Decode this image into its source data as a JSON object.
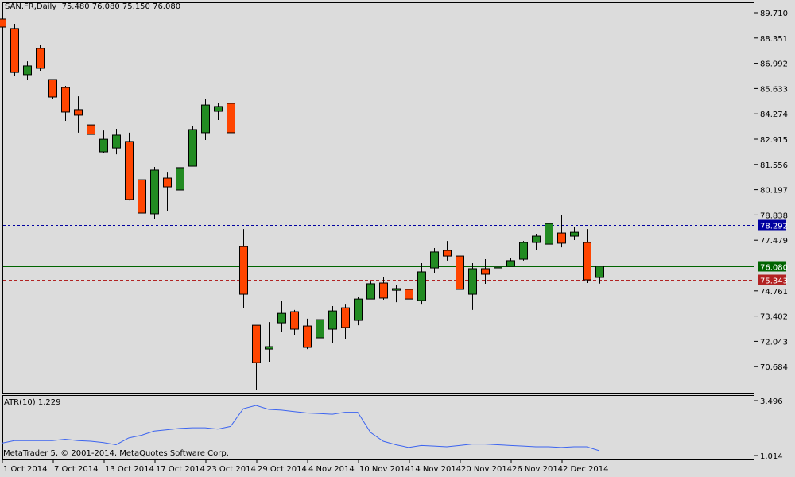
{
  "header": {
    "symbol": "SAN.FR,Daily",
    "ohlc": "75.480 76.080 75.150 76.080"
  },
  "indicator": {
    "label": "ATR(10) 1.229",
    "axis_labels": [
      "3.496",
      "1.014"
    ]
  },
  "copyright": "MetaTrader 5, © 2001-2014, MetaQuotes Software Corp.",
  "colors": {
    "background": "#dcdcdc",
    "bull": "#228b22",
    "bear": "#ff4500",
    "atr_line": "#3c64f0",
    "line_blue": "#0000a0",
    "line_green": "#006400",
    "line_red": "#b22222"
  },
  "price_axis": [
    "89.710",
    "88.351",
    "86.992",
    "85.633",
    "84.274",
    "82.915",
    "81.556",
    "80.197",
    "78.838",
    "77.479",
    "74.761",
    "73.402",
    "72.043",
    "70.684"
  ],
  "price_lines": [
    {
      "name": "blue-level",
      "value": "78.292",
      "color": "#0000a0",
      "style": "dotted"
    },
    {
      "name": "bid-level",
      "value": "76.080",
      "color": "#006400",
      "style": "solid"
    },
    {
      "name": "red-level",
      "value": "75.343",
      "color": "#b22222",
      "style": "dashed"
    }
  ],
  "date_axis": [
    {
      "label": "1 Oct 2014",
      "bar": 0
    },
    {
      "label": "7 Oct 2014",
      "bar": 4
    },
    {
      "label": "13 Oct 2014",
      "bar": 8
    },
    {
      "label": "17 Oct 2014",
      "bar": 12
    },
    {
      "label": "23 Oct 2014",
      "bar": 16
    },
    {
      "label": "29 Oct 2014",
      "bar": 20
    },
    {
      "label": "4 Nov 2014",
      "bar": 24
    },
    {
      "label": "10 Nov 2014",
      "bar": 28
    },
    {
      "label": "14 Nov 2014",
      "bar": 32
    },
    {
      "label": "20 Nov 2014",
      "bar": 36
    },
    {
      "label": "26 Nov 2014",
      "bar": 40
    },
    {
      "label": "2 Dec 2014",
      "bar": 44
    }
  ],
  "chart_data": {
    "type": "candlestick",
    "title": "SAN.FR,Daily",
    "ylim": [
      69.45,
      89.71
    ],
    "ohlc": [
      [
        89.37,
        89.37,
        88.94,
        88.94
      ],
      [
        88.86,
        89.11,
        86.33,
        86.5
      ],
      [
        86.38,
        87.1,
        86.12,
        86.85
      ],
      [
        87.79,
        87.96,
        86.59,
        86.72
      ],
      [
        86.12,
        86.12,
        85.05,
        85.18
      ],
      [
        85.69,
        85.78,
        83.9,
        84.37
      ],
      [
        84.5,
        85.22,
        83.26,
        84.2
      ],
      [
        83.68,
        84.07,
        82.83,
        83.17
      ],
      [
        82.23,
        83.38,
        82.15,
        82.91
      ],
      [
        82.44,
        83.47,
        82.1,
        83.13
      ],
      [
        82.79,
        83.26,
        79.62,
        79.67
      ],
      [
        80.73,
        81.29,
        77.27,
        78.94
      ],
      [
        78.9,
        81.42,
        78.6,
        81.25
      ],
      [
        80.82,
        81.16,
        79.07,
        80.35
      ],
      [
        80.18,
        81.55,
        79.5,
        81.38
      ],
      [
        81.46,
        83.64,
        81.46,
        83.43
      ],
      [
        83.26,
        85.09,
        82.87,
        84.75
      ],
      [
        84.41,
        84.88,
        83.94,
        84.67
      ],
      [
        84.84,
        85.14,
        82.79,
        83.26
      ],
      [
        77.14,
        78.08,
        73.81,
        74.58
      ],
      [
        72.91,
        72.91,
        69.45,
        70.9
      ],
      [
        71.63,
        73.08,
        70.95,
        71.76
      ],
      [
        73.04,
        74.2,
        72.57,
        73.55
      ],
      [
        73.64,
        73.73,
        72.36,
        72.7
      ],
      [
        72.87,
        73.26,
        71.63,
        71.72
      ],
      [
        72.23,
        73.3,
        71.46,
        73.21
      ],
      [
        72.7,
        73.94,
        71.93,
        73.68
      ],
      [
        73.85,
        74.02,
        72.19,
        72.79
      ],
      [
        73.17,
        74.45,
        72.91,
        74.32
      ],
      [
        74.32,
        75.26,
        74.32,
        75.14
      ],
      [
        75.18,
        75.52,
        74.28,
        74.37
      ],
      [
        74.79,
        75.05,
        74.15,
        74.88
      ],
      [
        74.84,
        75.18,
        74.2,
        74.32
      ],
      [
        74.24,
        76.25,
        74.02,
        75.78
      ],
      [
        75.99,
        77.06,
        75.73,
        76.85
      ],
      [
        76.93,
        77.44,
        76.38,
        76.63
      ],
      [
        76.63,
        76.67,
        73.64,
        74.84
      ],
      [
        74.58,
        76.25,
        73.73,
        75.95
      ],
      [
        75.95,
        76.46,
        75.14,
        75.65
      ],
      [
        75.99,
        76.5,
        75.73,
        76.08
      ],
      [
        76.08,
        76.55,
        76.08,
        76.38
      ],
      [
        76.46,
        77.44,
        76.38,
        77.36
      ],
      [
        77.36,
        77.83,
        76.93,
        77.7
      ],
      [
        77.27,
        78.68,
        77.1,
        78.38
      ],
      [
        77.87,
        78.81,
        77.1,
        77.32
      ],
      [
        77.7,
        78.17,
        77.49,
        77.91
      ],
      [
        77.36,
        78.08,
        75.18,
        75.35
      ],
      [
        75.48,
        76.08,
        75.15,
        76.08
      ]
    ],
    "atr": [
      1.57,
      1.69,
      1.69,
      1.69,
      1.69,
      1.75,
      1.69,
      1.66,
      1.6,
      1.5,
      1.81,
      1.93,
      2.12,
      2.18,
      2.24,
      2.27,
      2.27,
      2.21,
      2.33,
      3.13,
      3.28,
      3.1,
      3.07,
      3.0,
      2.94,
      2.91,
      2.88,
      2.97,
      2.97,
      2.06,
      1.66,
      1.5,
      1.38,
      1.47,
      1.44,
      1.41,
      1.47,
      1.53,
      1.53,
      1.5,
      1.47,
      1.44,
      1.41,
      1.41,
      1.38,
      1.41,
      1.41,
      1.229
    ],
    "atr_ylim": [
      1.014,
      3.496
    ]
  }
}
